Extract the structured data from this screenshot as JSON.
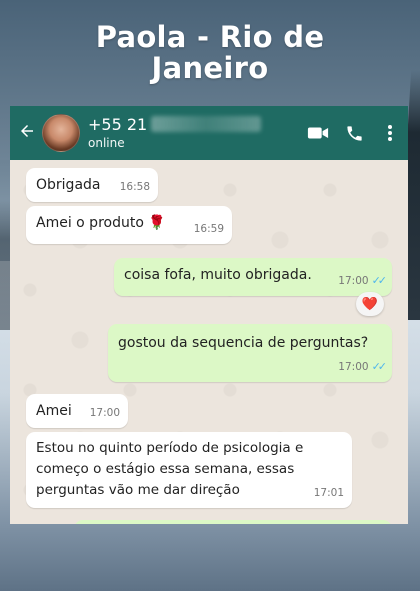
{
  "headline": {
    "line1": "Paola - Rio de",
    "line2": "Janeiro"
  },
  "header": {
    "phone_prefix": "+55 21",
    "status": "online"
  },
  "icons": {
    "back": "back-arrow-icon",
    "video": "video-call-icon",
    "call": "phone-call-icon",
    "menu": "more-vert-icon"
  },
  "messages": [
    {
      "side": "in",
      "text": "Obrigada",
      "time": "16:58"
    },
    {
      "side": "in",
      "text": "Amei o produto 🌹",
      "time": "16:59"
    },
    {
      "side": "out",
      "text": "coisa fofa, muito obrigada.",
      "time": "17:00",
      "read": true,
      "reaction": "❤️"
    },
    {
      "side": "out",
      "text": "gostou da sequencia de perguntas?",
      "time": "17:00",
      "read": true
    },
    {
      "side": "in",
      "text": "Amei",
      "time": "17:00"
    },
    {
      "side": "in",
      "line1": "Estou no quinto período de psicologia e",
      "line2": "começo o estágio essa semana, essas",
      "line3": "perguntas vão me dar direção",
      "time": "17:01"
    }
  ],
  "colors": {
    "header_bg": "#1f6b63",
    "incoming_bubble": "#ffffff",
    "outgoing_bubble": "#dcf8c6",
    "read_ticks": "#4fb6ec"
  }
}
